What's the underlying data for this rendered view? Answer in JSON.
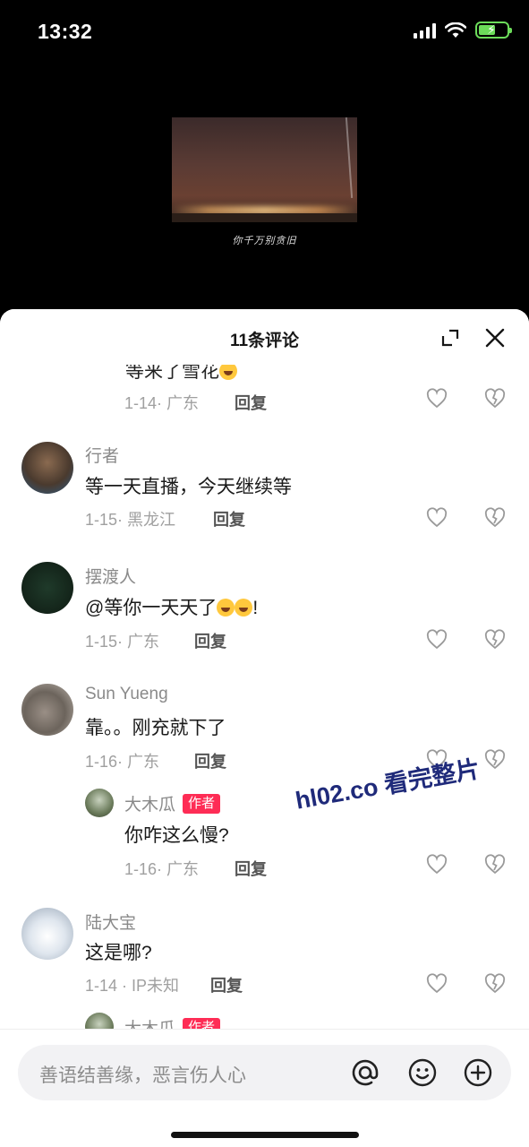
{
  "status_bar": {
    "time": "13:32"
  },
  "video": {
    "subtitle": "你千万别贪旧"
  },
  "sheet": {
    "title": "11条评论"
  },
  "partial_comment": {
    "text": "等来了雪花",
    "date_location": "1-14· 广东",
    "reply_label": "回复"
  },
  "comments": [
    {
      "name": "行者",
      "text": "等一天直播，今天继续等",
      "date_location": "1-15· 黑龙江",
      "reply_label": "回复"
    },
    {
      "name": "摆渡人",
      "text": "@等你一天天了",
      "text_suffix": "!",
      "date_location": "1-15· 广东",
      "reply_label": "回复"
    },
    {
      "name": "Sun Yueng",
      "text": "靠。。刚充就下了",
      "date_location": "1-16· 广东",
      "reply_label": "回复"
    }
  ],
  "reply": {
    "name": "大木瓜",
    "badge": "作者",
    "text": "你咋这么慢?",
    "date_location": "1-16· 广东",
    "reply_label": "回复"
  },
  "comment_last": {
    "name": "陆大宝",
    "text": "这是哪?",
    "date_location": "1-14 · IP未知",
    "reply_label": "回复"
  },
  "partial_reply": {
    "name": "大木瓜",
    "badge": "作者"
  },
  "input": {
    "placeholder": "善语结善缘，恶言伤人心"
  },
  "watermark": "hl02.co 看完整片",
  "colors": {
    "accent": "#fe2c55",
    "battery": "#6cdc5a"
  }
}
